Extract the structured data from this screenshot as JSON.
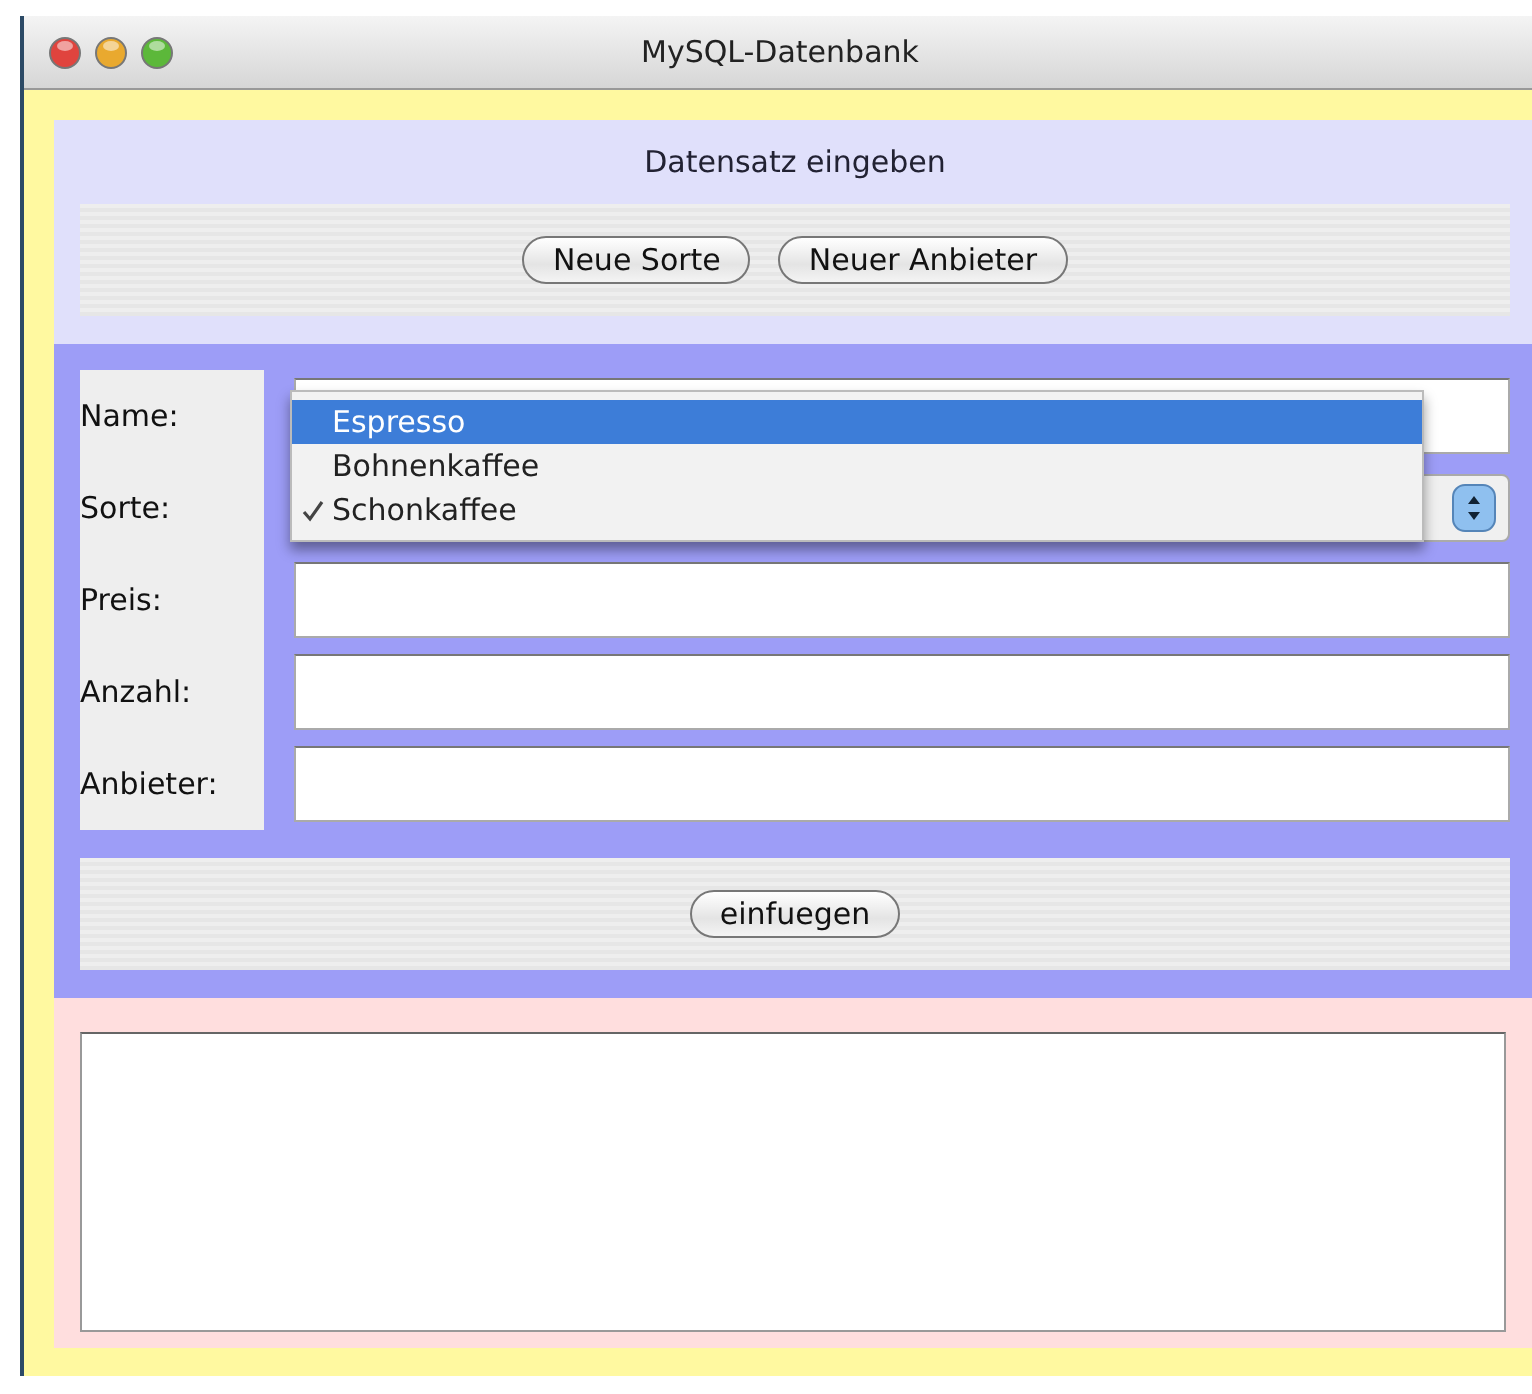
{
  "window": {
    "title": "MySQL-Datenbank"
  },
  "header": {
    "title": "Datensatz eingeben",
    "buttons": [
      "Neue Sorte",
      "Neuer Anbieter"
    ]
  },
  "form": {
    "fields": [
      {
        "kind": "text",
        "label": "Name:"
      },
      {
        "kind": "select",
        "label": "Sorte:",
        "options": [
          {
            "label": "Espresso",
            "selected": true,
            "checked": false
          },
          {
            "label": "Bohnenkaffee",
            "selected": false,
            "checked": false
          },
          {
            "label": "Schonkaffee",
            "selected": false,
            "checked": true
          }
        ]
      },
      {
        "kind": "text",
        "label": "Preis:"
      },
      {
        "kind": "text",
        "label": "Anzahl:"
      },
      {
        "kind": "text",
        "label": "Anbieter:"
      }
    ],
    "submit": "einfuegen"
  }
}
